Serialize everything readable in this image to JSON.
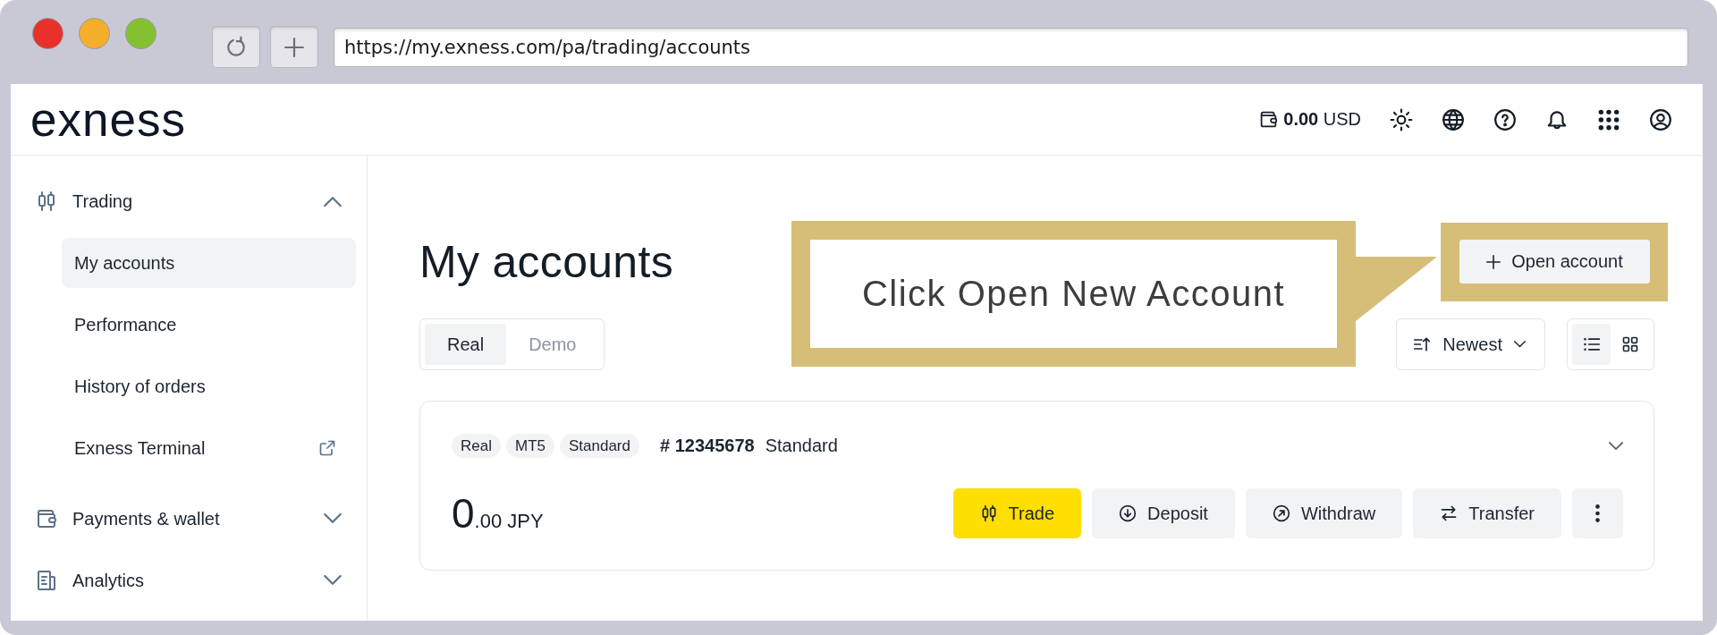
{
  "browser": {
    "window_controls": [
      {
        "color": "#e8312b"
      },
      {
        "color": "#f5ae2b"
      },
      {
        "color": "#84c131"
      }
    ],
    "url": "https://my.exness.com/pa/trading/accounts"
  },
  "header": {
    "logo": "exness",
    "balance": "**0.00** USD"
  },
  "sidebar": {
    "sections": [
      {
        "label": "Trading",
        "expanded": true,
        "children": [
          {
            "label": "My accounts",
            "selected": true,
            "external": false
          },
          {
            "label": "Performance",
            "selected": false,
            "external": false
          },
          {
            "label": "History of orders",
            "selected": false,
            "external": false
          },
          {
            "label": "Exness Terminal",
            "selected": false,
            "external": true
          }
        ]
      },
      {
        "label": "Payments & wallet",
        "expanded": false
      },
      {
        "label": "Analytics",
        "expanded": false
      }
    ]
  },
  "main": {
    "title": "My accounts",
    "open_account_button": {
      "label": "Open account",
      "highlighted": true
    },
    "callout": "Click Open New Account",
    "account_tabs": [
      {
        "label": "Real",
        "selected": true
      },
      {
        "label": "Demo",
        "selected": false
      }
    ],
    "sort": {
      "label": "Newest"
    },
    "view_modes": [
      {
        "selected": true
      },
      {
        "selected": false
      }
    ],
    "accounts": [
      {
        "tags": [
          "Real",
          "MT5",
          "Standard"
        ],
        "number": "# 12345678",
        "name": "Standard",
        "expanded": false,
        "balance": {
          "integer": "0",
          "fraction": ".00",
          "currency": "JPY"
        },
        "actions": [
          {
            "label": "Trade",
            "primary": true
          },
          {
            "label": "Deposit",
            "primary": false
          },
          {
            "label": "Withdraw",
            "primary": false
          },
          {
            "label": "Transfer",
            "primary": false
          }
        ]
      }
    ]
  }
}
